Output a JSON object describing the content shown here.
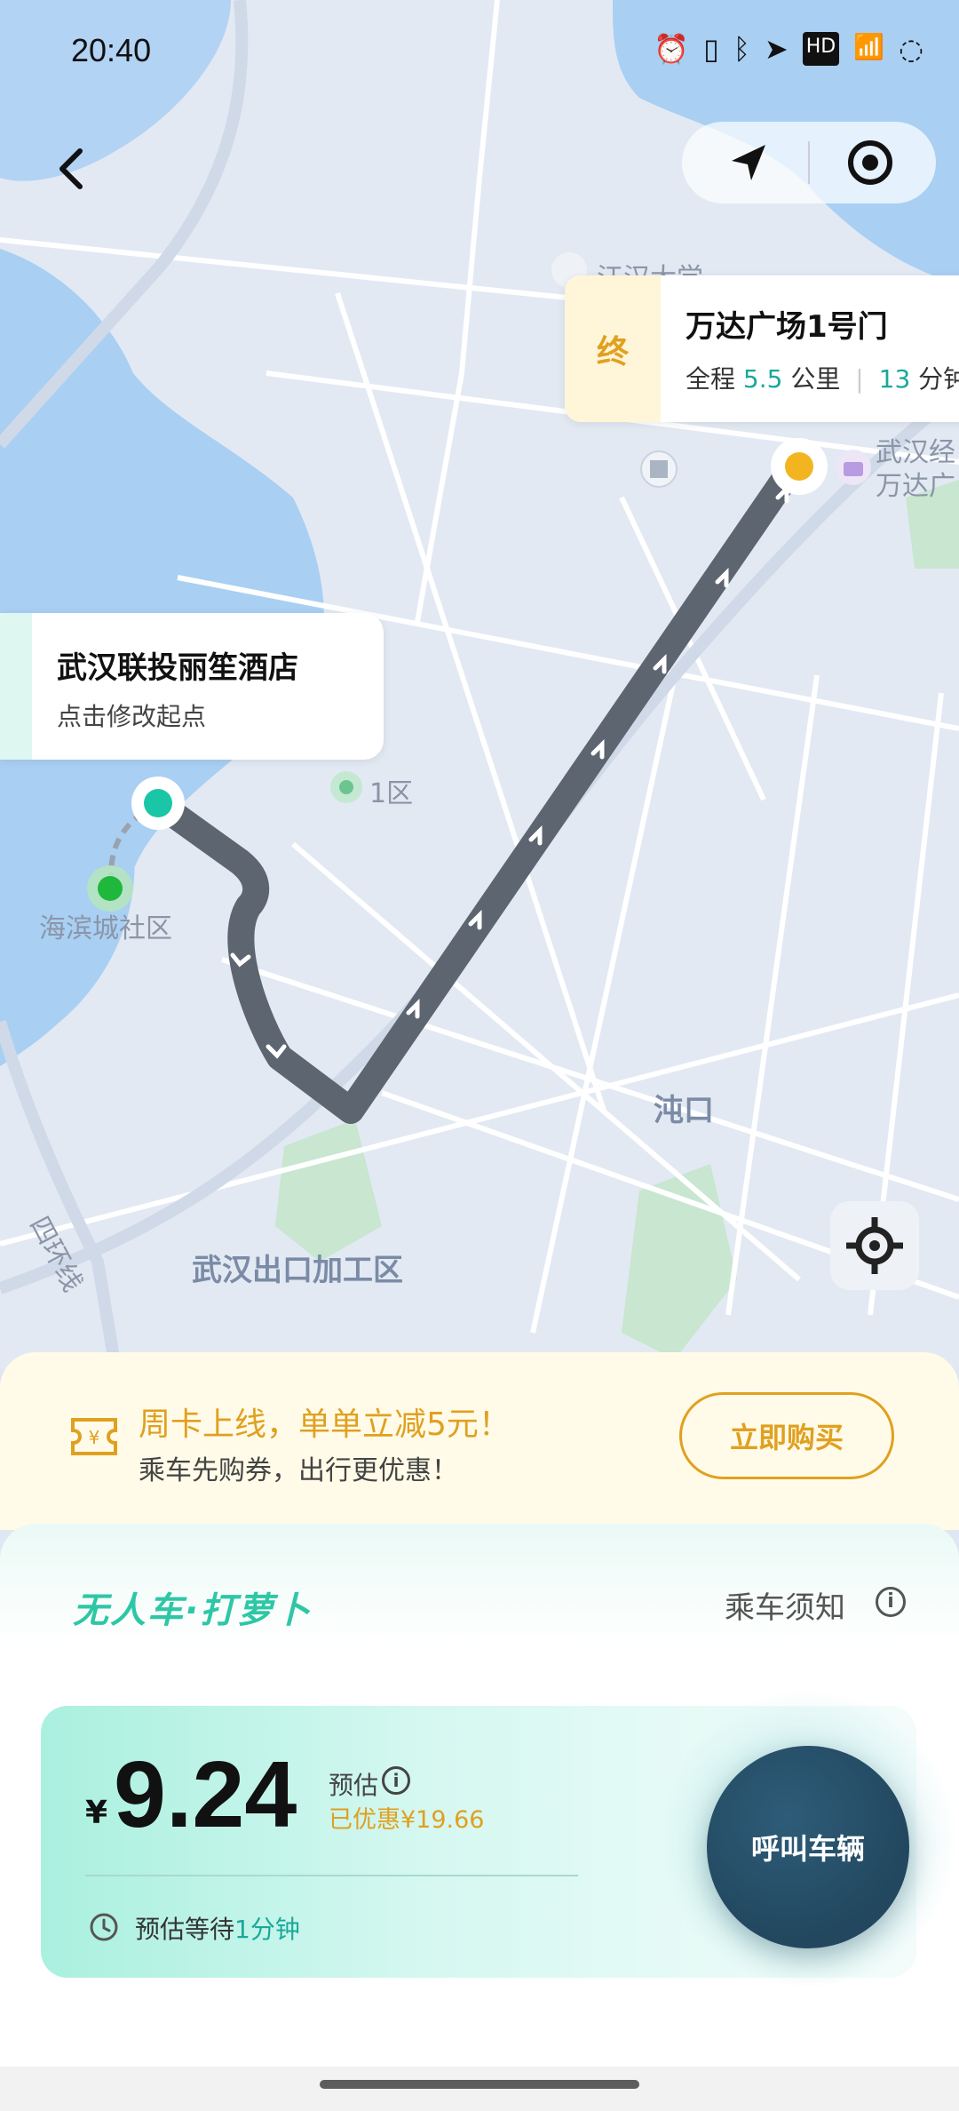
{
  "status_bar": {
    "time": "20:40",
    "icons": [
      "alarm-icon",
      "vibrate-icon",
      "bluetooth-icon",
      "location-arrow-icon",
      "hd-icon",
      "signal-4g-icon",
      "battery-icon"
    ]
  },
  "map": {
    "labels": {
      "district": "沌口",
      "zone": "武汉出口加工区",
      "ring_road": "四环线",
      "community": "海滨城社区",
      "area1": "1区",
      "university": "江汉大学",
      "wanda_line1": "武汉经",
      "wanda_line2": "万达广"
    }
  },
  "destination": {
    "tag": "终",
    "name": "万达广场1号门",
    "prefix": "全程",
    "distance": "5.5",
    "distance_unit": "公里",
    "duration": "13",
    "duration_unit": "分钟"
  },
  "start": {
    "name": "武汉联投丽笙酒店",
    "hint": "点击修改起点"
  },
  "promo": {
    "title": "周卡上线，单单立减5元！",
    "subtitle": "乘车先购券，出行更优惠！",
    "buy_label": "立即购买"
  },
  "panel": {
    "brand": "无人车·打萝卜",
    "notice_label": "乘车须知",
    "currency": "¥",
    "price": "9.24",
    "estimate_label": "预估",
    "discount": "已优惠¥19.66",
    "wait_prefix": "预估等待",
    "wait_value": "1分钟",
    "call_label": "呼叫车辆"
  },
  "colors": {
    "accent_green": "#1aa89a",
    "accent_gold": "#e0a020",
    "route": "#5c6570",
    "call_button": "#22475f"
  }
}
